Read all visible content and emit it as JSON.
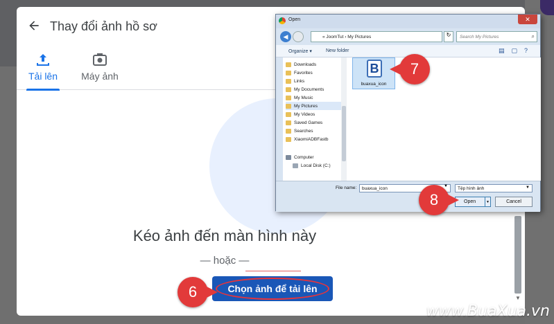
{
  "dialog": {
    "title": "Thay đổi ảnh hồ sơ",
    "tabs": [
      {
        "label": "Tải lên",
        "icon": "upload-icon",
        "active": true
      },
      {
        "label": "Máy ảnh",
        "icon": "camera-icon",
        "active": false
      }
    ],
    "drag_text": "Kéo ảnh đến màn hình này",
    "or_text": "— hoặc —",
    "choose_button": "Chọn ảnh để tải lên"
  },
  "open_dialog": {
    "title": "Open",
    "address_path": "« JoomTut › My Pictures",
    "search_placeholder": "Search My Pictures",
    "toolbar": {
      "organize": "Organize ▾",
      "new_folder": "New folder"
    },
    "nav_items": [
      {
        "label": "Downloads"
      },
      {
        "label": "Favorites"
      },
      {
        "label": "Links"
      },
      {
        "label": "My Documents"
      },
      {
        "label": "My Music"
      },
      {
        "label": "My Pictures",
        "selected": true
      },
      {
        "label": "My Videos"
      },
      {
        "label": "Saved Games"
      },
      {
        "label": "Searches"
      },
      {
        "label": "XiaomiADBFastb"
      },
      {
        "label": "Computer"
      },
      {
        "label": "Local Disk (C:)"
      }
    ],
    "file": {
      "name": "buaxua_icon",
      "icon_letter": "B"
    },
    "file_name_label": "File name:",
    "file_name_value": "buaxua_icon",
    "file_type": "Tệp hình ảnh",
    "open_button": "Open",
    "cancel_button": "Cancel"
  },
  "steps": [
    "6",
    "7",
    "8"
  ],
  "watermark": "www.BuaXua.vn",
  "colors": {
    "accent": "#1a73e8",
    "button": "#1a57b7",
    "step_marker": "#e23a3a"
  }
}
